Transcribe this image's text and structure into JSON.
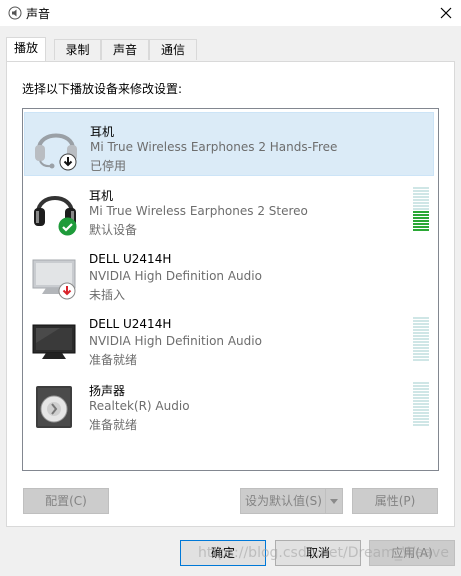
{
  "window": {
    "title": "声音"
  },
  "tabs": [
    {
      "label": "播放"
    },
    {
      "label": "录制"
    },
    {
      "label": "声音"
    },
    {
      "label": "通信"
    }
  ],
  "instruction": "选择以下播放设备来修改设置:",
  "devices": [
    {
      "name": "耳机",
      "description": "Mi True Wireless Earphones 2 Hands-Free",
      "status": "已停用",
      "icon": "headset-icon",
      "badge": "down-arrow-badge",
      "selected": true,
      "meter_level": null
    },
    {
      "name": "耳机",
      "description": "Mi True Wireless Earphones 2 Stereo",
      "status": "默认设备",
      "icon": "headset-icon",
      "badge": "checkmark-badge",
      "selected": false,
      "meter_level": 0.45
    },
    {
      "name": "DELL U2414H",
      "description": "NVIDIA High Definition Audio",
      "status": "未插入",
      "icon": "monitor-icon",
      "badge": "red-down-arrow-badge",
      "selected": false,
      "meter_level": null
    },
    {
      "name": "DELL U2414H",
      "description": "NVIDIA High Definition Audio",
      "status": "准备就绪",
      "icon": "monitor-icon",
      "badge": null,
      "selected": false,
      "meter_level": 0
    },
    {
      "name": "扬声器",
      "description": "Realtek(R) Audio",
      "status": "准备就绪",
      "icon": "speaker-icon",
      "badge": null,
      "selected": false,
      "meter_level": 0
    }
  ],
  "buttons": {
    "configure": "配置(C)",
    "set_default": "设为默认值(S)",
    "properties": "属性(P)",
    "ok": "确定",
    "cancel": "取消",
    "apply": "应用(A)"
  },
  "watermark": "https://blog.csdn.net/Dream_Weave"
}
